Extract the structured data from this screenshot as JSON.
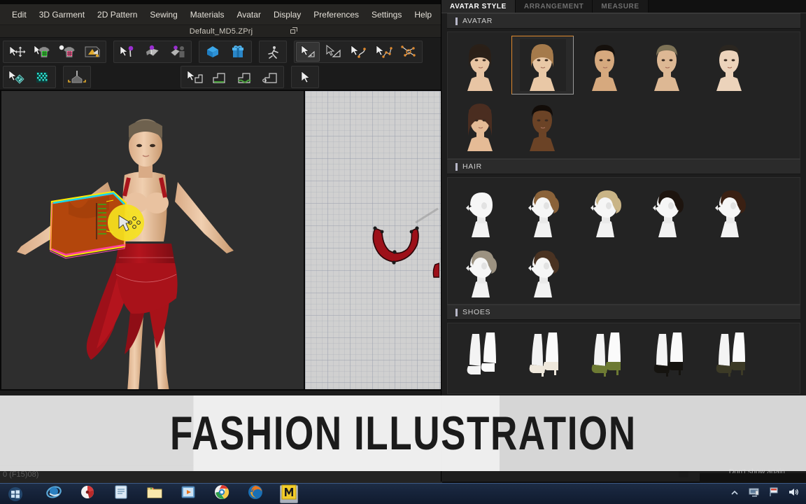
{
  "app": {
    "title": "Default_MD5.ZPrj",
    "menu": [
      {
        "label": "Edit",
        "name": "menu-edit"
      },
      {
        "label": "3D Garment",
        "name": "menu-3d-garment"
      },
      {
        "label": "2D Pattern",
        "name": "menu-2d-pattern"
      },
      {
        "label": "Sewing",
        "name": "menu-sewing"
      },
      {
        "label": "Materials",
        "name": "menu-materials"
      },
      {
        "label": "Avatar",
        "name": "menu-avatar"
      },
      {
        "label": "Display",
        "name": "menu-display"
      },
      {
        "label": "Preferences",
        "name": "menu-preferences"
      },
      {
        "label": "Settings",
        "name": "menu-settings"
      },
      {
        "label": "Help",
        "name": "menu-help"
      }
    ],
    "status": "0   (F15)08)"
  },
  "toolbar": {
    "row1": [
      {
        "name": "transform-tool",
        "icon": "arrow-move-icon",
        "selected": false
      },
      {
        "name": "select-mesh-tool",
        "icon": "shirt-green-icon",
        "selected": false
      },
      {
        "name": "select-mesh-box-tool",
        "icon": "shirt-pink-icon",
        "selected": false
      },
      {
        "name": "fold-arrangement-tool",
        "icon": "fold-arrange-icon",
        "selected": false
      },
      {
        "name": "pin-tool",
        "icon": "arrow-pin-icon",
        "selected": false
      },
      {
        "name": "pin-fabric-tool",
        "icon": "pin-fabric-icon",
        "selected": false
      },
      {
        "name": "avatar-pin-tool",
        "icon": "avatar-pin-icon",
        "selected": false
      },
      {
        "name": "arrange-gizmo-tool",
        "icon": "blue-arrange-icon",
        "selected": false
      },
      {
        "name": "gift-box-tool",
        "icon": "blue-box-icon",
        "selected": false
      },
      {
        "name": "animation-tool",
        "icon": "running-person-icon",
        "selected": false
      }
    ],
    "row2": [
      {
        "name": "texture-select-tool",
        "icon": "arrow-texture-icon",
        "selected": false
      },
      {
        "name": "checker-texture-tool",
        "icon": "checker-icon",
        "selected": false
      },
      {
        "name": "symmetry-tool",
        "icon": "symmetry-arrows-icon",
        "selected": false
      },
      {
        "name": "plane-select-tool",
        "icon": "arrow-plane-icon",
        "selected": false
      },
      {
        "name": "plane-tool",
        "icon": "plane-icon",
        "selected": false
      }
    ],
    "row1b": [
      {
        "name": "polygon-select-tool",
        "icon": "arrow-triangle-icon",
        "selected": true
      },
      {
        "name": "polygon-draw-tool",
        "icon": "triangle-icon",
        "selected": false
      },
      {
        "name": "curve-tool",
        "icon": "arrow-curve-icon",
        "selected": false
      },
      {
        "name": "point-tool",
        "icon": "arrow-points-icon",
        "selected": false
      },
      {
        "name": "edit-point-tool",
        "icon": "points-edit-icon",
        "selected": false
      }
    ],
    "row2b": [
      {
        "name": "sew-select-tool",
        "icon": "arrow-sew-icon",
        "selected": false
      },
      {
        "name": "segment-sew-tool",
        "icon": "segment-sew-icon",
        "selected": false
      },
      {
        "name": "free-sew-tool",
        "icon": "free-sew-icon",
        "selected": false
      },
      {
        "name": "sew-edit-tool",
        "icon": "sew-edit-icon",
        "selected": false
      },
      {
        "name": "more-tools",
        "icon": "arrow-more-icon",
        "selected": false
      }
    ]
  },
  "panel": {
    "tabs": [
      {
        "label": "AVATAR STYLE",
        "active": true,
        "name": "tab-avatar-style"
      },
      {
        "label": "ARRANGEMENT",
        "active": false,
        "name": "tab-arrangement"
      },
      {
        "label": "MEASURE",
        "active": false,
        "name": "tab-measure"
      }
    ],
    "sections": [
      {
        "title": "AVATAR",
        "name": "section-avatar",
        "kind": "face",
        "items": [
          {
            "name": "avatar-female-dark-bob",
            "hair": "#2a2018",
            "skin": "#e8c5a4",
            "selected": false,
            "style": "bob"
          },
          {
            "name": "avatar-female-blonde-bob",
            "hair": "#a57a4b",
            "skin": "#e9c8a6",
            "selected": true,
            "style": "bob"
          },
          {
            "name": "avatar-male-asian",
            "hair": "#15100c",
            "skin": "#d6a97e",
            "selected": false,
            "style": "short"
          },
          {
            "name": "avatar-male-caucasian",
            "hair": "#7d7256",
            "skin": "#ddb894",
            "selected": false,
            "style": "short"
          },
          {
            "name": "avatar-child",
            "hair": "#2b2620",
            "skin": "#ecd3bb",
            "selected": false,
            "style": "short"
          },
          {
            "name": "avatar-female-brunette",
            "hair": "#4a2d20",
            "skin": "#e5bb96",
            "selected": false,
            "style": "long"
          },
          {
            "name": "avatar-male-dark-skin",
            "hair": "#120c08",
            "skin": "#6b4326",
            "selected": false,
            "style": "short"
          }
        ]
      },
      {
        "title": "HAIR",
        "name": "section-hair",
        "kind": "profile",
        "items": [
          {
            "name": "hair-none",
            "hair": "none",
            "selected": false
          },
          {
            "name": "hair-ponytail-brown",
            "hair": "#8a6239",
            "selected": false
          },
          {
            "name": "hair-bun-blonde",
            "hair": "#c9b486",
            "selected": false
          },
          {
            "name": "hair-bun-black",
            "hair": "#1d140e",
            "selected": false
          },
          {
            "name": "hair-bob-dark-brown",
            "hair": "#3a2013",
            "selected": false
          },
          {
            "name": "hair-short-ash",
            "hair": "#9c9281",
            "selected": false
          },
          {
            "name": "hair-short-brown",
            "hair": "#4a3322",
            "selected": false
          }
        ]
      },
      {
        "title": "SHOES",
        "name": "section-shoes",
        "kind": "shoes",
        "items": [
          {
            "name": "shoes-barefoot",
            "color": "none",
            "selected": false
          },
          {
            "name": "shoes-white-pumps",
            "color": "#efe8dc",
            "selected": false
          },
          {
            "name": "shoes-green-wedges",
            "color": "#6d7a33",
            "selected": false
          },
          {
            "name": "shoes-black-strappy-heels",
            "color": "#15130f",
            "selected": false
          },
          {
            "name": "shoes-olive-ankle-boots",
            "color": "#3c3a26",
            "selected": false
          }
        ]
      }
    ],
    "dont_show_again": "Don't show again"
  },
  "overlay": {
    "title": "FASHION ILLUSTRATION"
  },
  "taskbar": {
    "items": [
      {
        "name": "taskbar-internet-explorer",
        "icon": "internet-explorer-icon"
      },
      {
        "name": "taskbar-media-app",
        "icon": "red-disc-icon"
      },
      {
        "name": "taskbar-notepad",
        "icon": "document-icon"
      },
      {
        "name": "taskbar-explorer",
        "icon": "folder-icon"
      },
      {
        "name": "taskbar-media-player",
        "icon": "media-player-icon"
      },
      {
        "name": "taskbar-chrome",
        "icon": "chrome-icon"
      },
      {
        "name": "taskbar-firefox",
        "icon": "firefox-icon"
      },
      {
        "name": "taskbar-marvelous-designer",
        "icon": "m-letter-icon"
      }
    ],
    "tray": [
      {
        "name": "tray-show-hidden",
        "icon": "chevron-up-icon"
      },
      {
        "name": "tray-network",
        "icon": "monitor-icon"
      },
      {
        "name": "tray-action-center",
        "icon": "flag-icon"
      },
      {
        "name": "tray-volume",
        "icon": "speaker-icon"
      }
    ]
  },
  "colors": {
    "accent": "#e08a2e",
    "panel_bg": "#1d1d1d",
    "garment_red": "#a8141c",
    "pattern_orange": "#b3460c"
  }
}
